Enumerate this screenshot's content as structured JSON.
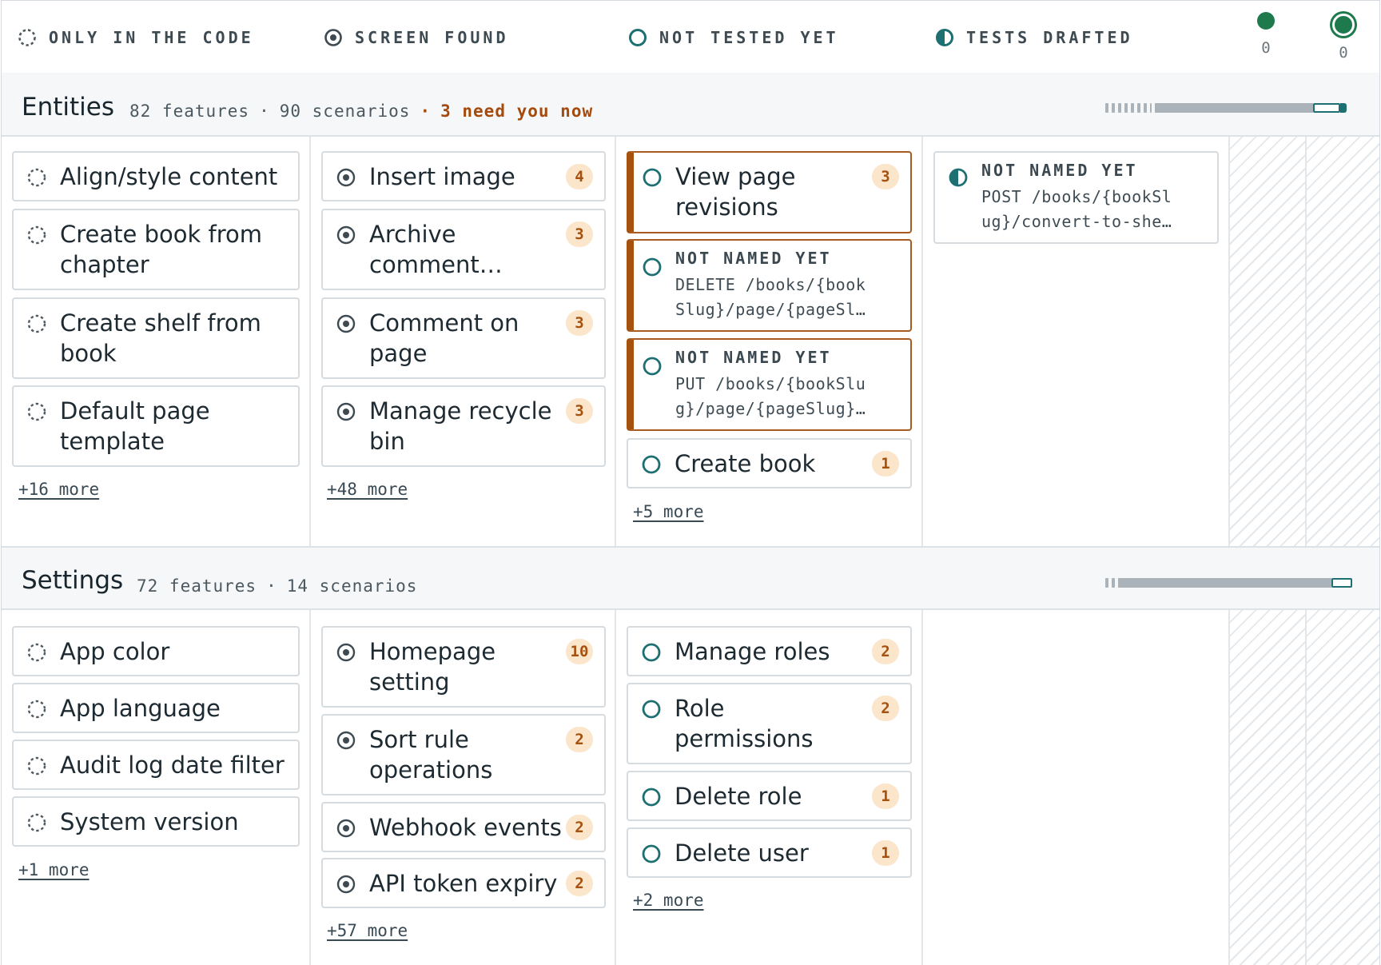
{
  "legend": {
    "only_in_code": "ONLY IN THE CODE",
    "screen_found": "SCREEN FOUND",
    "not_tested_yet": "NOT TESTED YET",
    "tests_drafted": "TESTS DRAFTED",
    "stat_one": "0",
    "stat_two": "0"
  },
  "sections": [
    {
      "title": "Entities",
      "features": "82 features",
      "dot": "·",
      "scenarios": "90 scenarios",
      "need": "3 need you now",
      "columns": [
        {
          "cards": [
            {
              "title": "Align/style content"
            },
            {
              "title": "Create book from\nchapter"
            },
            {
              "title": "Create shelf from\nbook"
            },
            {
              "title": "Default page\ntemplate"
            }
          ],
          "more": "+16 more"
        },
        {
          "cards": [
            {
              "title": "Insert image",
              "badge": "4"
            },
            {
              "title": "Archive\ncomment…",
              "badge": "3"
            },
            {
              "title": "Comment on\npage",
              "badge": "3"
            },
            {
              "title": "Manage recycle\nbin",
              "badge": "3"
            }
          ],
          "more": "+48 more"
        },
        {
          "cards": [
            {
              "title": "View page\nrevisions",
              "badge": "3"
            },
            {
              "unnamed": "NOT NAMED YET",
              "route": "DELETE /books/{book\nSlug}/page/{pageSl…"
            },
            {
              "unnamed": "NOT NAMED YET",
              "route": "PUT /books/{bookSlu\ng}/page/{pageSlug}…"
            },
            {
              "title": "Create book",
              "badge": "1"
            }
          ],
          "more": "+5 more"
        },
        {
          "cards": [
            {
              "unnamed": "NOT NAMED YET",
              "route": "POST /books/{bookSl\nug}/convert-to-she…"
            }
          ]
        }
      ],
      "progress": {
        "drafted_fraction": 0.04
      }
    },
    {
      "title": "Settings",
      "features": "72 features",
      "dot": "·",
      "scenarios": "14 scenarios",
      "columns": [
        {
          "cards": [
            {
              "title": "App color"
            },
            {
              "title": "App language"
            },
            {
              "title": "Audit log date filter"
            },
            {
              "title": "System version"
            }
          ],
          "more": "+1 more"
        },
        {
          "cards": [
            {
              "title": "Homepage\nsetting",
              "badge": "10"
            },
            {
              "title": "Sort rule\noperations",
              "badge": "2"
            },
            {
              "title": "Webhook events",
              "badge": "2"
            },
            {
              "title": "API token expiry",
              "badge": "2"
            }
          ],
          "more": "+57 more"
        },
        {
          "cards": [
            {
              "title": "Manage roles",
              "badge": "2"
            },
            {
              "title": "Role\npermissions",
              "badge": "2"
            },
            {
              "title": "Delete role",
              "badge": "1"
            },
            {
              "title": "Delete user",
              "badge": "1"
            }
          ],
          "more": "+2 more"
        }
      ],
      "progress": {
        "drafted_fraction": 0.09
      }
    }
  ],
  "colors": {
    "accent": "#1d6f72",
    "urgent": "#a5520f",
    "badge_bg": "#fbe5cb",
    "verified": "#1e7a4c"
  }
}
